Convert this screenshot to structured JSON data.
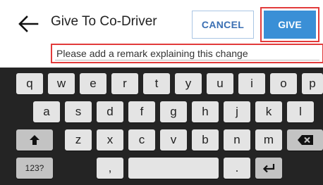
{
  "header": {
    "title": "Give To Co-Driver",
    "cancel_label": "CANCEL",
    "give_label": "GIVE"
  },
  "remark": {
    "placeholder": "Please add a remark explaining this change",
    "value": ""
  },
  "keyboard": {
    "row1": [
      "q",
      "w",
      "e",
      "r",
      "t",
      "y",
      "u",
      "i",
      "o",
      "p"
    ],
    "row2": [
      "a",
      "s",
      "d",
      "f",
      "g",
      "h",
      "j",
      "k",
      "l"
    ],
    "row3": [
      "z",
      "x",
      "c",
      "v",
      "b",
      "n",
      "m"
    ],
    "numbers_label": "123?",
    "comma_label": ",",
    "period_label": ".",
    "shift_icon": "shift-icon",
    "backspace_icon": "backspace-icon",
    "enter_icon": "enter-icon"
  },
  "colors": {
    "accent": "#3a8fd6",
    "highlight": "#e23b3b",
    "keyboard_bg": "#242424"
  }
}
